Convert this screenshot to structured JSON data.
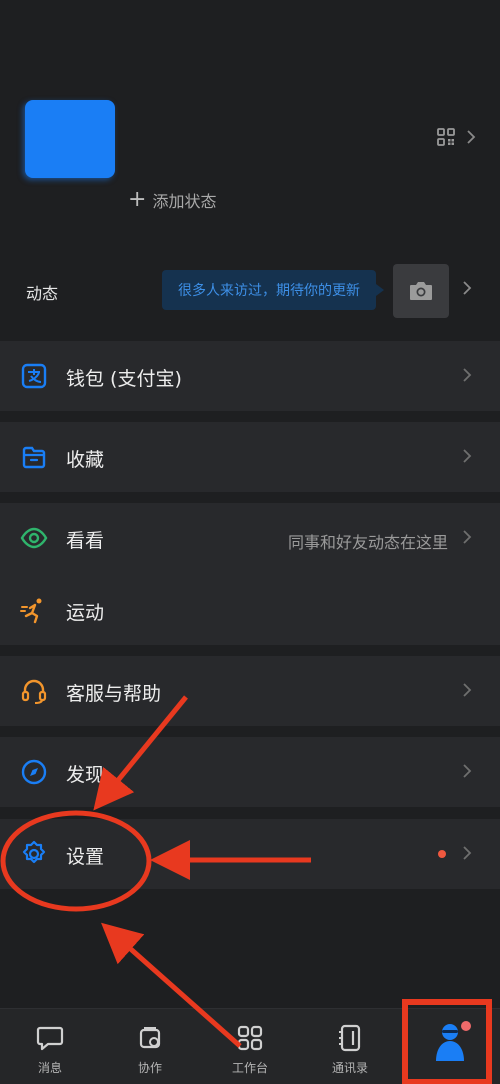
{
  "profile": {
    "add_status_label": "添加状态"
  },
  "moments": {
    "label": "动态",
    "tip": "很多人来访过，期待你的更新"
  },
  "menu": {
    "wallet_label": "钱包 (支付宝)",
    "favorites_label": "收藏",
    "watch_label": "看看",
    "watch_hint": "同事和好友动态在这里",
    "sports_label": "运动",
    "support_label": "客服与帮助",
    "discover_label": "发现",
    "settings_label": "设置"
  },
  "tabbar": {
    "tabs": [
      {
        "label": "消息",
        "icon": "chat-icon"
      },
      {
        "label": "协作",
        "icon": "collab-icon"
      },
      {
        "label": "工作台",
        "icon": "workbench-icon"
      },
      {
        "label": "通讯录",
        "icon": "contacts-icon"
      },
      {
        "label": "",
        "icon": "me-avatar"
      }
    ]
  },
  "colors": {
    "accent_blue": "#1a7ef5",
    "annotation_red": "#e8391f",
    "watch_green": "#2fb46c",
    "sports_orange": "#f2952c"
  }
}
